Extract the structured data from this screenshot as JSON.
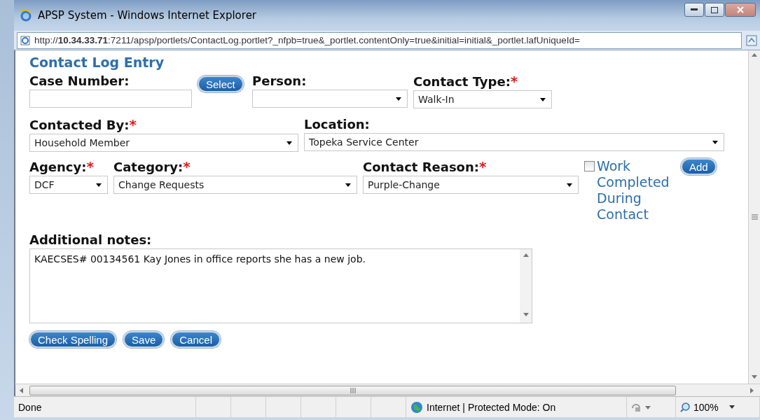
{
  "window": {
    "title": "APSP System - Windows Internet Explorer"
  },
  "address_bar": {
    "url": "http://**10.34.33.71**:7211/apsp/portlets/ContactLog.portlet?_nfpb=true&_portlet.contentOnly=true&initial=initial&_portlet.lafUniqueId="
  },
  "form": {
    "title": "Contact Log Entry",
    "rows": [
      {
        "items": [
          {
            "kind": "text",
            "label": "Case Number:"
          },
          {
            "kind": "button",
            "label": "Select"
          },
          {
            "kind": "select",
            "label": "Person:"
          },
          {
            "kind": "select",
            "label": "Contact Type:",
            "required_mark": "*",
            "value": "Walk-In"
          }
        ]
      },
      {
        "items": [
          {
            "kind": "select",
            "label": "Contacted By:",
            "required_mark": "*",
            "value": "Household Member"
          },
          {
            "kind": "select",
            "label": "Location:",
            "value": "Topeka Service Center"
          }
        ]
      },
      {
        "items": [
          {
            "kind": "select",
            "label": "Agency:",
            "required_mark": "*",
            "value": "DCF"
          },
          {
            "kind": "select",
            "label": "Category:",
            "required_mark": "*",
            "value": "Change Requests"
          },
          {
            "kind": "select",
            "label": "Contact Reason:",
            "required_mark": "*",
            "value": "Purple-Change"
          },
          {
            "kind": "checkbox",
            "label": "Work Completed During Contact",
            "checked": false
          },
          {
            "kind": "button",
            "label": "Add"
          }
        ]
      }
    ],
    "notes": {
      "label": "Additional notes:",
      "value": "KAECSES# 00134561 Kay Jones in office reports she has a new job."
    },
    "buttons": [
      "Check Spelling",
      "Save",
      "Cancel"
    ]
  },
  "status_bar": {
    "status": "Done",
    "zone": "Internet | Protected Mode: On",
    "zoom": "100%"
  }
}
